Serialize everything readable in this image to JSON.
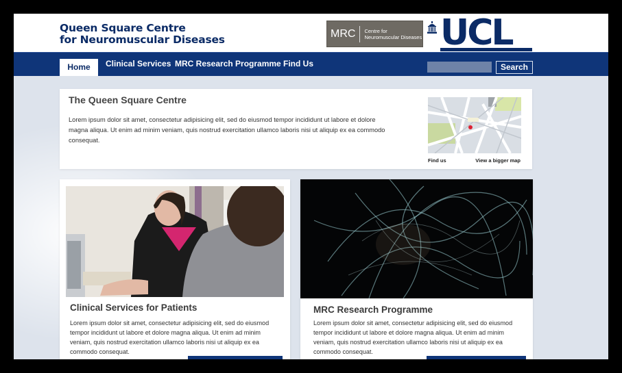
{
  "header": {
    "site_title_line1": "Queen Square Centre",
    "site_title_line2": "for Neuromuscular Diseases",
    "mrc_logo_abbr": "MRC",
    "mrc_logo_line1": "Centre for",
    "mrc_logo_line2": "Neuromuscular Diseases",
    "ucl_logo": "UCL"
  },
  "nav": {
    "tabs": [
      {
        "label": "Home",
        "active": true
      },
      {
        "label": "Clinical Services"
      },
      {
        "label": "MRC Research Programme"
      },
      {
        "label": "Find Us"
      }
    ],
    "search_button": "Search",
    "search_placeholder": ""
  },
  "intro": {
    "title": "The Queen Square Centre",
    "body": "Lorem ipsum dolor sit amet, consectetur adipisicing elit, sed do eiusmod tempor incididunt ut labore et dolore magna aliqua. Ut enim ad minim veniam, quis nostrud exercitation ullamco laboris nisi ut aliquip ex ea commodo consequat.",
    "map_link_find": "Find us",
    "map_link_bigger": "View a bigger map"
  },
  "cards": [
    {
      "title": "Clinical Services for Patients",
      "body": "Lorem ipsum dolor sit amet, consectetur adipisicing elit, sed do eiusmod tempor incididunt ut labore et dolore magna aliqua. Ut enim ad minim veniam, quis nostrud exercitation ullamco laboris nisi ut aliquip ex ea commodo consequat."
    },
    {
      "title": "MRC Research Programme",
      "body": "Lorem ipsum dolor sit amet, consectetur adipisicing elit, sed do eiusmod tempor incididunt ut labore et dolore magna aliqua. Ut enim ad minim veniam, quis nostrud exercitation ullamco laboris nisi ut aliquip ex ea commodo consequat."
    }
  ],
  "colors": {
    "brand_navy": "#0f3579",
    "title_navy": "#0b2b66",
    "mrc_grey": "#6e6a63",
    "page_bg": "#dde3ec"
  },
  "icons": [
    "ucl-building-icon"
  ]
}
